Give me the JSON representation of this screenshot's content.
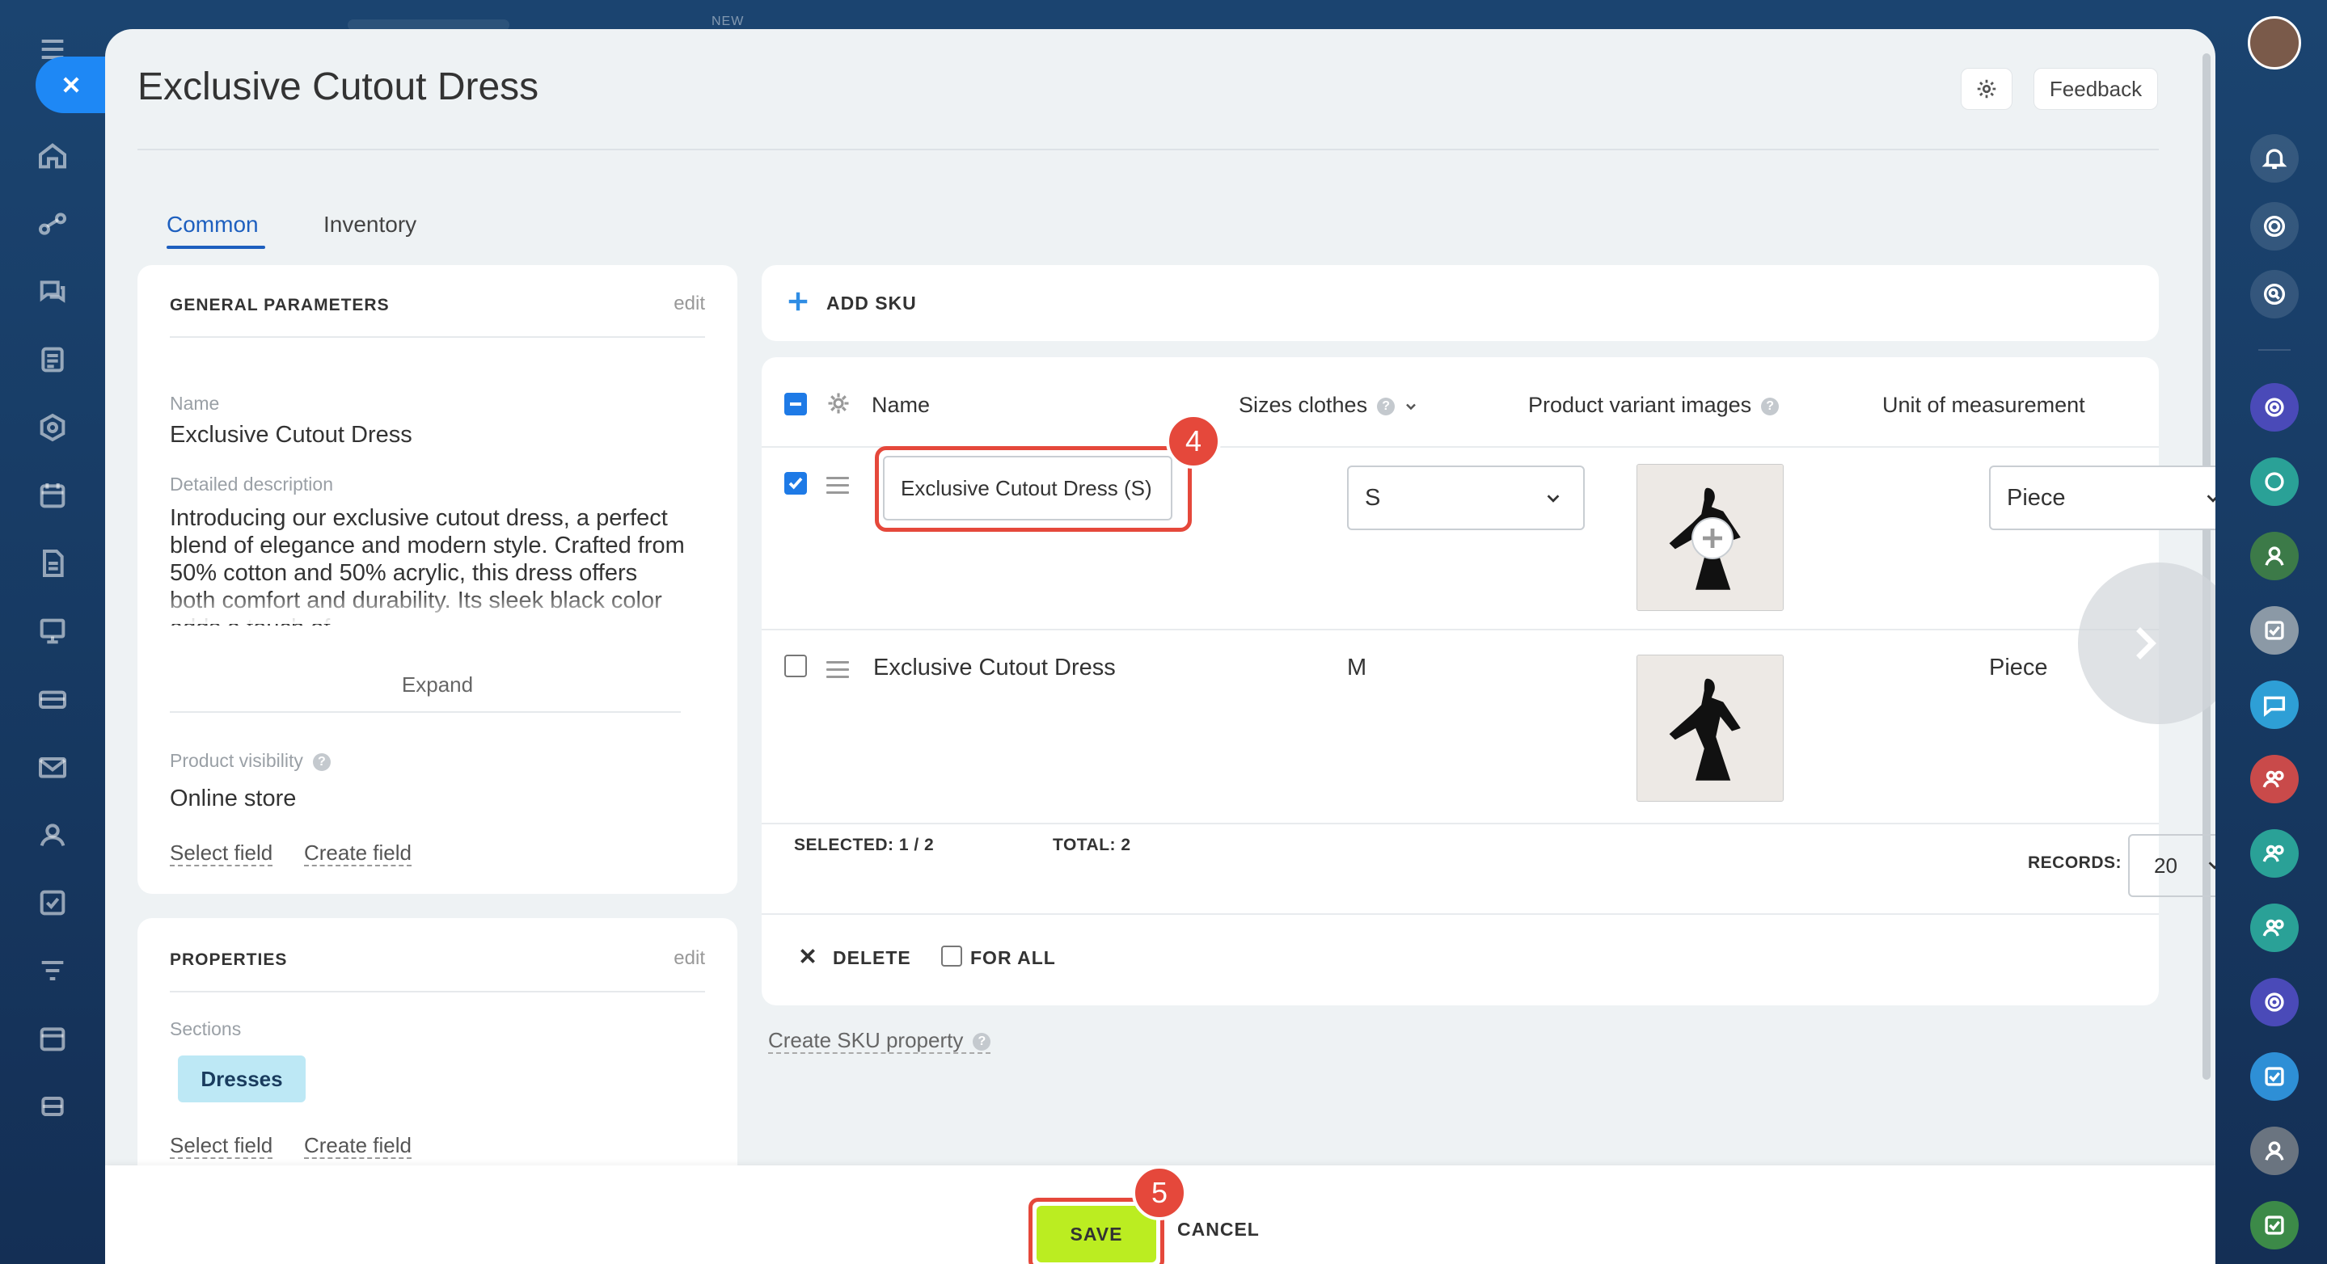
{
  "topbar": {
    "new_label": "NEW"
  },
  "header": {
    "title": "Exclusive Cutout Dress",
    "feedback_label": "Feedback"
  },
  "tabs": [
    {
      "label": "Common",
      "active": true
    },
    {
      "label": "Inventory",
      "active": false
    }
  ],
  "general": {
    "heading": "GENERAL PARAMETERS",
    "edit_label": "edit",
    "name_label": "Name",
    "name_value": "Exclusive Cutout Dress",
    "description_label": "Detailed description",
    "description_value": "Introducing our exclusive cutout dress, a perfect blend of elegance and modern style. Crafted from 50% cotton and 50% acrylic, this dress offers both comfort and durability. Its sleek black color adds a touch of",
    "expand_label": "Expand",
    "visibility_label": "Product visibility",
    "visibility_value": "Online store",
    "select_field": "Select field",
    "create_field": "Create field"
  },
  "properties": {
    "heading": "PROPERTIES",
    "edit_label": "edit",
    "sections_label": "Sections",
    "section_tag": "Dresses",
    "select_field": "Select field",
    "create_field": "Create field"
  },
  "sku": {
    "add_label": "ADD SKU",
    "columns": [
      "Name",
      "Sizes clothes",
      "Product variant images",
      "Unit of measurement"
    ],
    "rows": [
      {
        "selected": true,
        "name": "Exclusive Cutout Dress (S)",
        "size": "S",
        "unit": "Piece",
        "editing": true
      },
      {
        "selected": false,
        "name": "Exclusive Cutout Dress",
        "size": "M",
        "unit": "Piece",
        "editing": false
      }
    ],
    "selected_label": "SELECTED:",
    "selected_value": "1 / 2",
    "total_label": "TOTAL:",
    "total_value": "2",
    "records_label": "RECORDS:",
    "records_value": "20",
    "delete_label": "DELETE",
    "for_all_label": "FOR ALL",
    "create_property": "Create SKU property"
  },
  "steps": {
    "name_step": "4",
    "save_step": "5"
  },
  "footer": {
    "save_label": "SAVE",
    "cancel_label": "CANCEL"
  },
  "colors": {
    "accent": "#1e7ae6",
    "save": "#bbed21",
    "highlight": "#e5483b",
    "tag": "#bde8f5"
  }
}
